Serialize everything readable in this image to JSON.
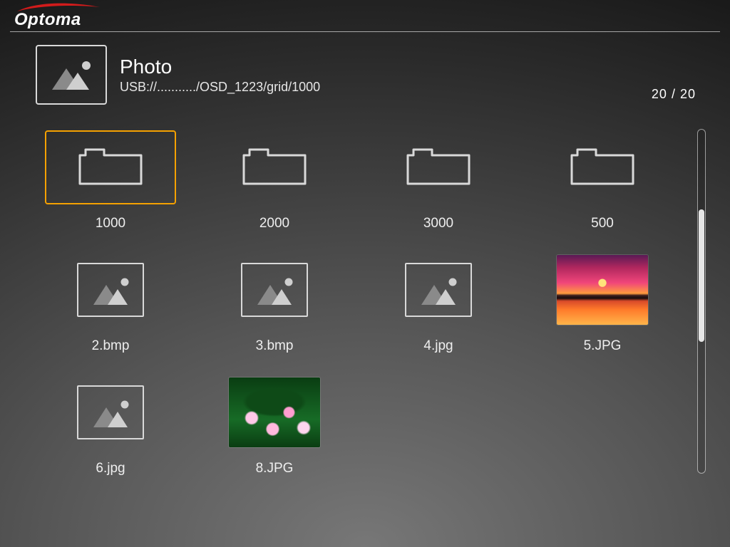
{
  "brand": "Optoma",
  "header": {
    "title": "Photo",
    "path": "USB://.........../OSD_1223/grid/1000",
    "page_current": "20",
    "page_total": "20",
    "page_sep": " / "
  },
  "grid": {
    "items": [
      {
        "kind": "folder",
        "label": "1000",
        "selected": true
      },
      {
        "kind": "folder",
        "label": "2000"
      },
      {
        "kind": "folder",
        "label": "3000"
      },
      {
        "kind": "folder",
        "label": "500"
      },
      {
        "kind": "image_placeholder",
        "label": "2.bmp"
      },
      {
        "kind": "image_placeholder",
        "label": "3.bmp"
      },
      {
        "kind": "image_placeholder",
        "label": "4.jpg"
      },
      {
        "kind": "photo",
        "style": "sunset",
        "label": "5.JPG"
      },
      {
        "kind": "image_placeholder",
        "label": "6.jpg"
      },
      {
        "kind": "photo",
        "style": "flowers",
        "label": "8.JPG"
      }
    ]
  }
}
